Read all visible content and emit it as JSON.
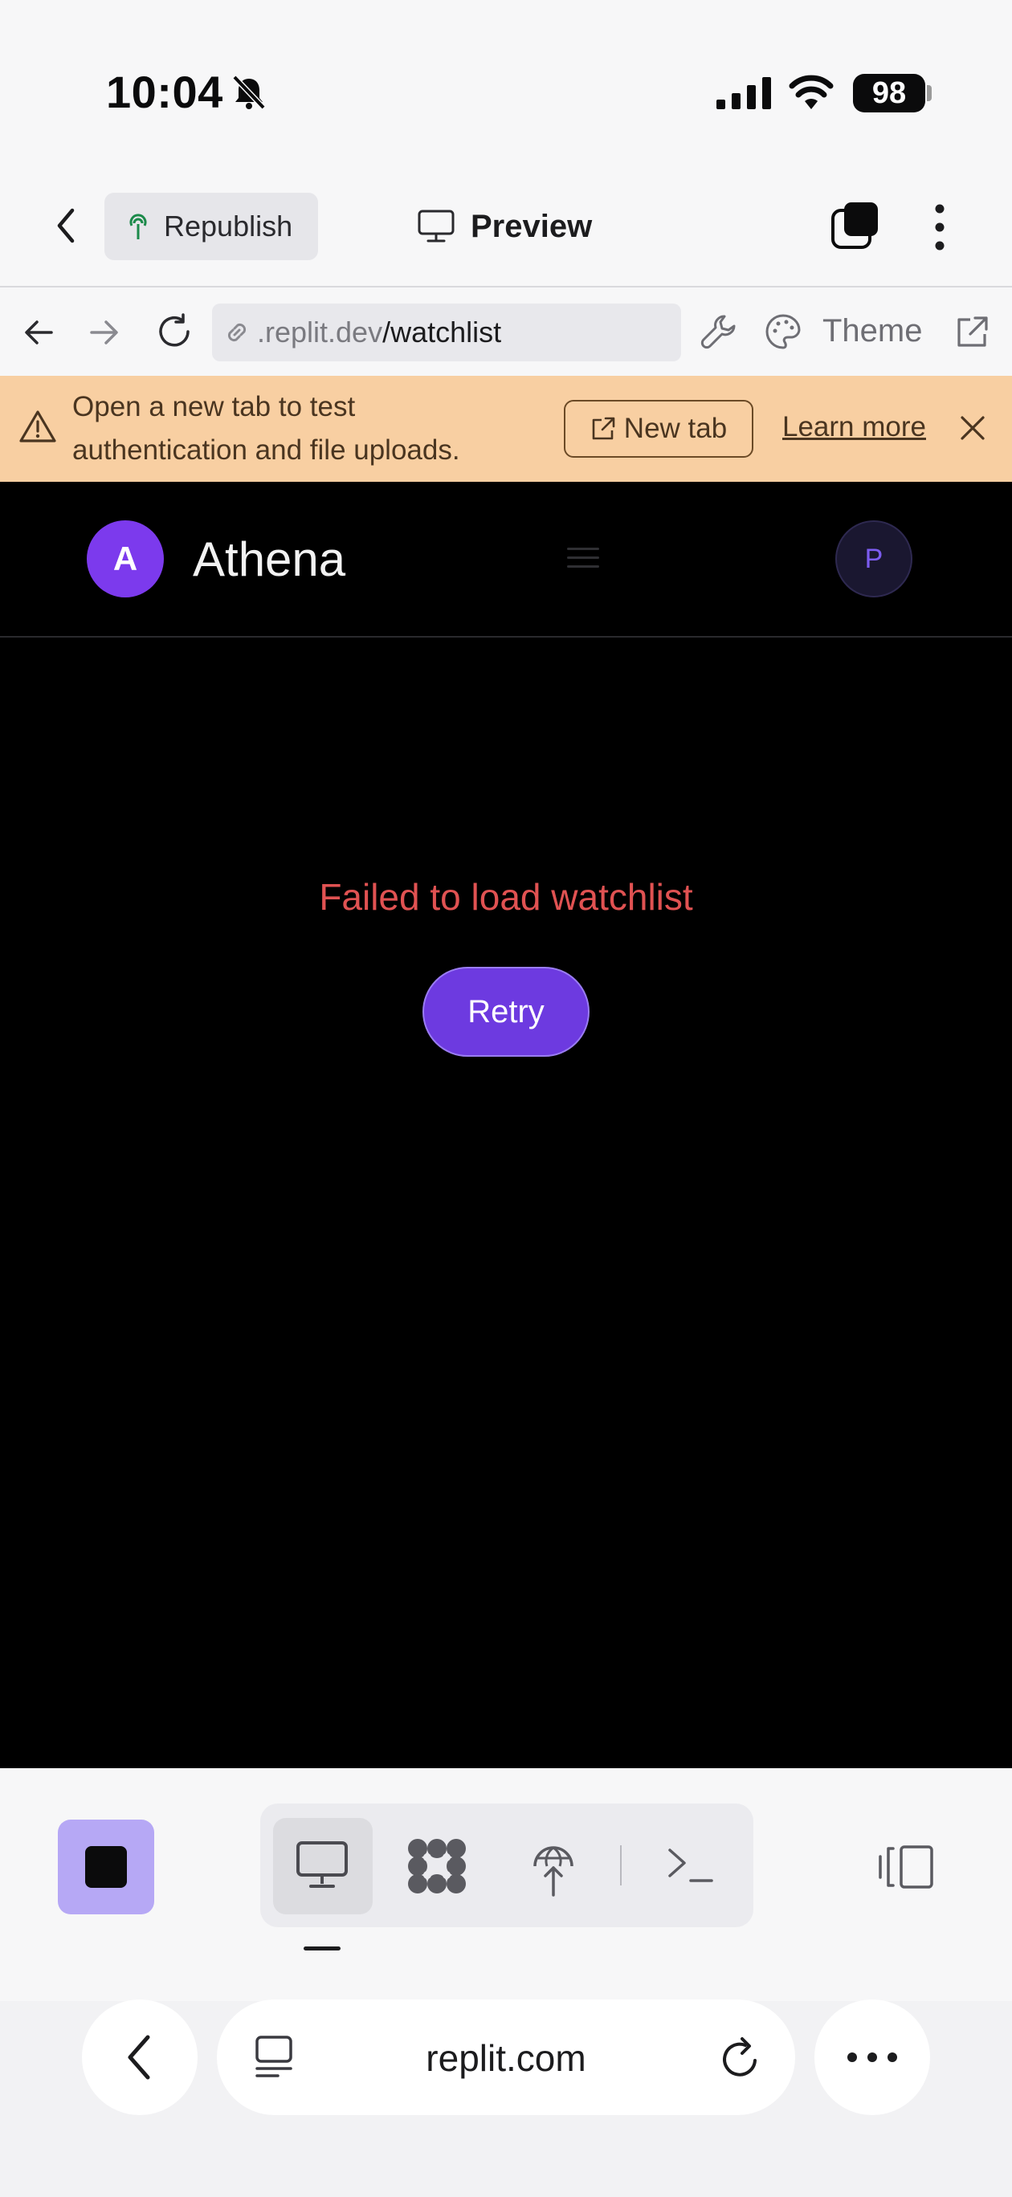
{
  "status_bar": {
    "time": "10:04",
    "battery": "98"
  },
  "header": {
    "republish_label": "Republish",
    "title": "Preview"
  },
  "url_bar": {
    "domain_part": ".replit.dev",
    "path_part": "/watchlist",
    "theme_label": "Theme"
  },
  "banner": {
    "message": "Open a new tab to test authentication and file uploads.",
    "new_tab_label": "New tab",
    "learn_more_label": "Learn more"
  },
  "app": {
    "logo_letter": "A",
    "name": "Athena",
    "profile_letter": "P",
    "error_message": "Failed to load watchlist",
    "retry_label": "Retry"
  },
  "browser": {
    "address": "replit.com"
  },
  "colors": {
    "accent": "#7c3aed",
    "banner_bg": "#f8cfa2",
    "error": "#e05252",
    "stop_bg": "#b6a8f5"
  }
}
